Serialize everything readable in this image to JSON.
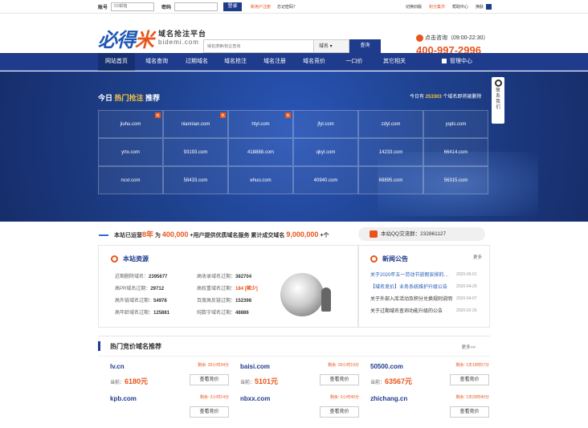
{
  "top": {
    "account_label": "账号",
    "account_placeholder": "ID/邮箱",
    "pwd_label": "密码",
    "login": "登录",
    "register": "新用户注册",
    "forgot": "忘记密码？",
    "links": [
      "切换旧版",
      "积分集市",
      "帮助中心",
      "换肤"
    ]
  },
  "logo": {
    "cn1": "必得",
    "cn2": "米",
    "slogan": "域名抢注平台",
    "domain": "bidemi.com"
  },
  "search": {
    "placeholder": "域名搜索/抢企查询",
    "select": "域名 ▾",
    "button": "查询"
  },
  "contact": {
    "label": "点击咨询（09:00-22:30）",
    "phone": "400-997-2996"
  },
  "nav": {
    "items": [
      "网站首页",
      "域名查询",
      "过期域名",
      "域名抢注",
      "域名注册",
      "域名竞价",
      "一口价",
      "其它相关"
    ],
    "manage": "管理中心"
  },
  "hero": {
    "title_a": "今日 ",
    "title_b": "热门抢注",
    "title_c": " 推荐",
    "count_a": "今日有 ",
    "count_num": "253303",
    "count_b": " 个域名即将被删除",
    "side": "联系我们"
  },
  "hot_domains": [
    "jiuhu.com",
    "niannian.com",
    "htyl.com",
    "jfyl.com",
    "zdyl.com",
    "yqds.com",
    "yrtx.com",
    "93193.com",
    "418888.com",
    "qkyl.com",
    "14233.com",
    "66414.com",
    "ncxr.com",
    "58433.com",
    "ehuo.com",
    "40940.com",
    "69895.com",
    "56315.com"
  ],
  "hot_flags": [
    1,
    1,
    1,
    0,
    0,
    0,
    0,
    0,
    0,
    0,
    0,
    0,
    0,
    0,
    0,
    0,
    0,
    0
  ],
  "hot_flag_label": "热",
  "stats": {
    "a": "本站已运营",
    "years": "8年",
    "b": " 为 ",
    "users": "400,000",
    "c": " +用户提供优质域名服务  累计成交域名 ",
    "deals": "9,000,000",
    "d": " +个"
  },
  "qq": "本站QQ交流群：232861127",
  "resources": {
    "title": "本站资源",
    "items": [
      {
        "label": "近期删除域名：",
        "value": "2395677"
      },
      {
        "label": "高收录域名过期：",
        "value": "382704"
      },
      {
        "label": "高PR域名过期：",
        "value": "29712"
      },
      {
        "label": "高权重域名过期：",
        "value": "184 [稀少]"
      },
      {
        "label": "高外链域名过期：",
        "value": "54978"
      },
      {
        "label": "百度高反链过期：",
        "value": "152398"
      },
      {
        "label": "高年龄域名过期：",
        "value": "125881"
      },
      {
        "label": "纯数字域名过期：",
        "value": "48886"
      }
    ]
  },
  "news": {
    "title": "新闻公告",
    "more": "更多",
    "items": [
      {
        "t": "关于2020年五一劳动节放假安排的通知",
        "d": "2020-05-01"
      },
      {
        "t": "【域名竞价】业务系统维护升级公告",
        "d": "2020-04-20"
      },
      {
        "t": "关于外部入库活动及积分兑换规则说明",
        "d": "2020-04-07"
      },
      {
        "t": "关于过期域名查询功能升级的公告",
        "d": "2020-02-26"
      }
    ]
  },
  "auction": {
    "title": "热门竞价域名推荐",
    "more": "更多>>",
    "bid": "查看竞价",
    "price_label": "当前：",
    "cards": [
      {
        "domain": "lv.cn",
        "left": "剩余: 20小时34分",
        "price": "6180元"
      },
      {
        "domain": "baisi.com",
        "left": "剩余: 20小时19分",
        "price": "5101元"
      },
      {
        "domain": "50500.com",
        "left": "剩余: 1天10时57分",
        "price": "63567元"
      },
      {
        "domain": "kpb.com",
        "left": "剩余: 2小时14分",
        "price": ""
      },
      {
        "domain": "nbxx.com",
        "left": "剩余: 2小时40分",
        "price": ""
      },
      {
        "domain": "zhichang.cn",
        "left": "剩余: 1天20时40分",
        "price": ""
      }
    ]
  },
  "colors": {
    "primary": "#1f3b8c",
    "accent": "#e8541a",
    "gold": "#f7c53c"
  }
}
